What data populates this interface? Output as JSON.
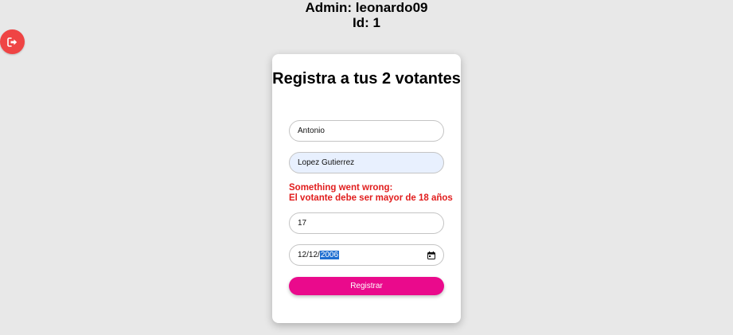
{
  "header": {
    "admin_line": "Admin: leonardo09",
    "id_line": "Id: 1"
  },
  "logout": {
    "icon": "logout-icon",
    "color": "#ef4444"
  },
  "form": {
    "title": "Registra a tus 2 votantes",
    "first_name_value": "Antonio",
    "last_name_value": "Lopez Gutierrez",
    "error_line1": "Something went wrong:",
    "error_line2": "El votante debe ser mayor de 18 años",
    "age_value": "17",
    "date_day_month": "12/12/",
    "date_year": "2006",
    "submit_label": "Registrar"
  },
  "colors": {
    "background": "#e8e8e8",
    "error": "#e11d1d",
    "submit": "#ea0a8c",
    "autofill": "#e8f0fe",
    "selection": "#1f6fd1"
  }
}
